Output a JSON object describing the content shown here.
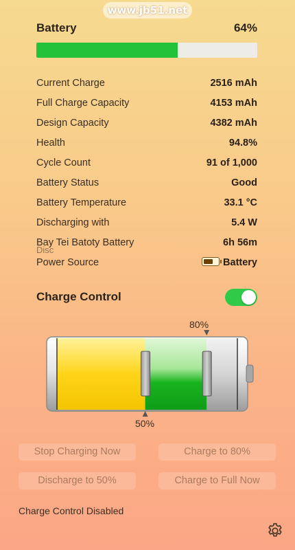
{
  "watermark": "www.jb51.net",
  "battery": {
    "title": "Battery",
    "percent_label": "64%",
    "level": 0.64
  },
  "details": [
    {
      "label": "Current Charge",
      "value": "2516 mAh"
    },
    {
      "label": "Full Charge Capacity",
      "value": "4153 mAh"
    },
    {
      "label": "Design Capacity",
      "value": "4382 mAh"
    },
    {
      "label": "Health",
      "value": "94.8%"
    },
    {
      "label": "Cycle Count",
      "value": "91 of 1,000"
    },
    {
      "label": "Battery Status",
      "value": "Good"
    },
    {
      "label": "Battery Temperature",
      "value": "33.1 °C"
    },
    {
      "label": "Discharging with",
      "value": "5.4 W"
    },
    {
      "label": "Bay Tei Batoty Battery",
      "value": "6h 56m",
      "ghost": "Disc"
    },
    {
      "label": "Power Source",
      "value": "Battery",
      "icon": "battery-icon"
    }
  ],
  "charge_control": {
    "title": "Charge Control",
    "enabled": true,
    "upper_limit_label": "80%",
    "lower_limit_label": "50%",
    "upper_limit": 0.8,
    "lower_limit": 0.5
  },
  "buttons": {
    "stop_charging": "Stop Charging Now",
    "charge_to_80": "Charge to 80%",
    "discharge_to_50": "Discharge to 50%",
    "charge_full": "Charge to Full Now"
  },
  "status": "Charge Control Disabled",
  "icons": {
    "settings": "gear-icon"
  },
  "colors": {
    "accent_green": "#22c13a",
    "battery_yellow": "#ffd419"
  }
}
